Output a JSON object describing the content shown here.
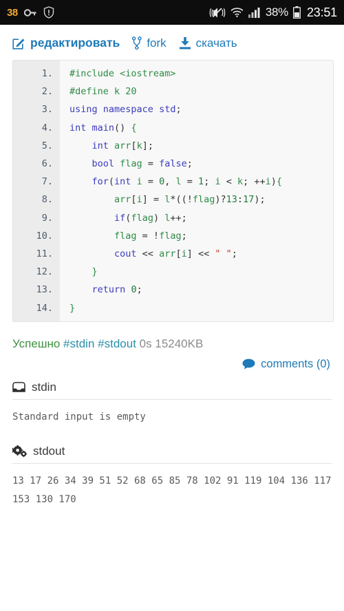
{
  "statusbar": {
    "notification_count": "38",
    "icons_left": [
      "vpn-key-icon",
      "shield-alert-icon"
    ],
    "icons_right": [
      "vibrate-mute-icon",
      "wifi-icon",
      "signal-bars-icon",
      "battery-icon"
    ],
    "battery_percent": "38%",
    "clock": "23:51",
    "background": "#0d0d0d",
    "count_color": "#f0a830"
  },
  "toolbar": {
    "accent_color": "#1e7ab8",
    "edit_label": "редактировать",
    "fork_label": "fork",
    "download_label": "скачать"
  },
  "code": {
    "language": "cpp",
    "lines": [
      {
        "n": "1.",
        "text": "#include <iostream>"
      },
      {
        "n": "2.",
        "text": "#define k 20"
      },
      {
        "n": "3.",
        "text": "using namespace std;"
      },
      {
        "n": "4.",
        "text": "int main() {"
      },
      {
        "n": "5.",
        "text": "    int arr[k];"
      },
      {
        "n": "6.",
        "text": "    bool flag = false;"
      },
      {
        "n": "7.",
        "text": "    for(int i = 0, l = 1; i < k; ++i){"
      },
      {
        "n": "8.",
        "text": "        arr[i] = l*((!flag)?13:17);"
      },
      {
        "n": "9.",
        "text": "        if(flag) l++;"
      },
      {
        "n": "10.",
        "text": "        flag = !flag;"
      },
      {
        "n": "11.",
        "text": "        cout << arr[i] << \" \";"
      },
      {
        "n": "12.",
        "text": "    }"
      },
      {
        "n": "13.",
        "text": "    return 0;"
      },
      {
        "n": "14.",
        "text": "}"
      }
    ]
  },
  "result": {
    "status": "Успешно",
    "stdin_link": "#stdin",
    "stdout_link": "#stdout",
    "time": "0s",
    "memory": "15240KB",
    "status_color": "#3f9142",
    "link_color": "#2a8fa8"
  },
  "comments": {
    "label": "comments (0)",
    "icon": "comment-bubble-icon"
  },
  "stdin": {
    "title": "stdin",
    "icon": "inbox-tray-icon",
    "body": "Standard input is empty"
  },
  "stdout": {
    "title": "stdout",
    "icon": "gears-icon",
    "body": "13 17 26 34 39 51 52 68 65 85 78 102 91 119 104 136 117 153 130 170"
  }
}
